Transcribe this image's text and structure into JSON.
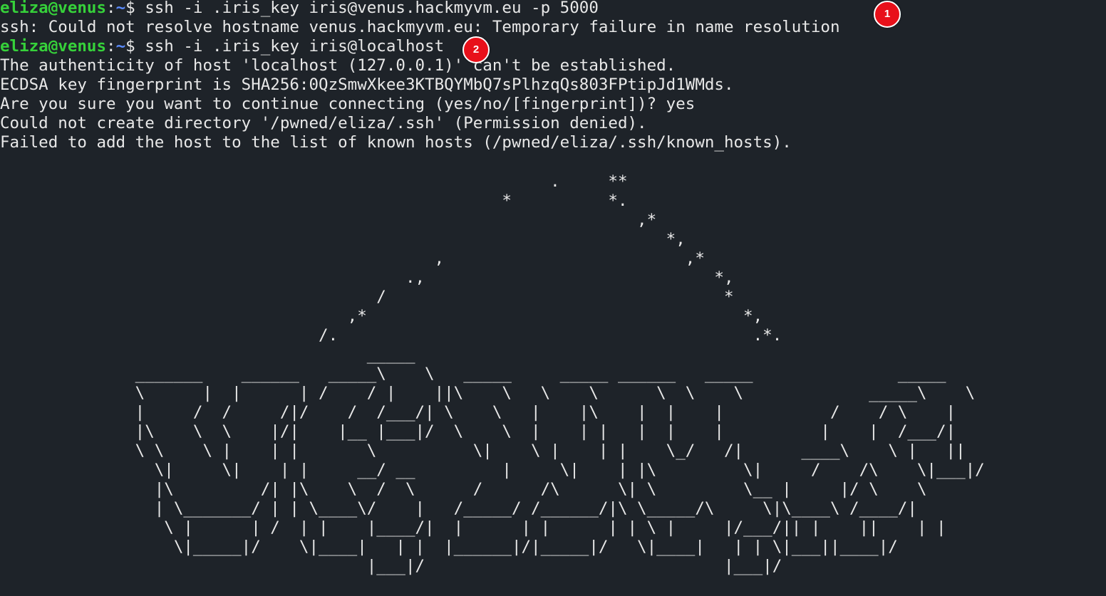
{
  "prompt": {
    "user": "eliza@venus",
    "colon": ":",
    "path": "~",
    "symbol": "$ "
  },
  "lines": [
    {
      "type": "prompt",
      "command": "ssh -i .iris_key iris@venus.hackmyvm.eu -p 5000"
    },
    {
      "type": "output",
      "text": "ssh: Could not resolve hostname venus.hackmyvm.eu: Temporary failure in name resolution"
    },
    {
      "type": "prompt",
      "command": "ssh -i .iris_key iris@localhost"
    },
    {
      "type": "output",
      "text": "The authenticity of host 'localhost (127.0.0.1)' can't be established."
    },
    {
      "type": "output",
      "text": "ECDSA key fingerprint is SHA256:0QzSmwXkee3KTBQYMbQ7sPlhzqQs803FPtipJd1WMds."
    },
    {
      "type": "output",
      "text": "Are you sure you want to continue connecting (yes/no/[fingerprint])? yes"
    },
    {
      "type": "output",
      "text": "Could not create directory '/pwned/eliza/.ssh' (Permission denied)."
    },
    {
      "type": "output",
      "text": "Failed to add the host to the list of known hosts (/pwned/eliza/.ssh/known_hosts)."
    }
  ],
  "ascii_art": "                                                         .     **\n                                                    *          *.\n                                                                  ,*\n                                                                     *,\n                                             ,                         ,*\n                                          .,                              *,\n                                       /                                   *\n                                    ,*                                       *,\n                                 /.                                           .*.\n                                      _____\n              _______    ______   _____\\    \\   _____     _____ ______   _____               _____\n              \\      |  |      | /    / |    ||\\    \\   \\    \\      \\  \\    \\             _____\\    \\\n              |     /  /     /|/    /  /___/| \\    \\   |    |\\    |  |    |           /    / \\    |\n              |\\    \\  \\    |/|    |__ |___|/  \\    \\  |    | |   |  |    |          |    |  /___/|\n              \\ \\    \\ |    | |       \\          \\|    \\ |    | |    \\_/   /|      ____\\    \\ |   ||\n                \\|     \\|    | |     __/ __         |     \\|    | |\\         \\|     /    /\\    \\|___|/\n                |\\         /| |\\    \\  /  \\      /      /\\      \\| \\         \\__ |     |/ \\    \\\n                | \\_______/ | | \\____\\/    |   /_____/ /______/|\\ \\_____/\\     \\|\\____\\ /____/|\n                 \\ |      | /  | |    |____/|  |      | |      | | \\ |     |/___/|| |    ||    | |\n                  \\|_____|/    \\|____|   | |  |______|/|_____|/   \\|____|   | | \\|___||____|/\n                                      |___|/                               |___|/",
  "markers": [
    "1",
    "2"
  ]
}
